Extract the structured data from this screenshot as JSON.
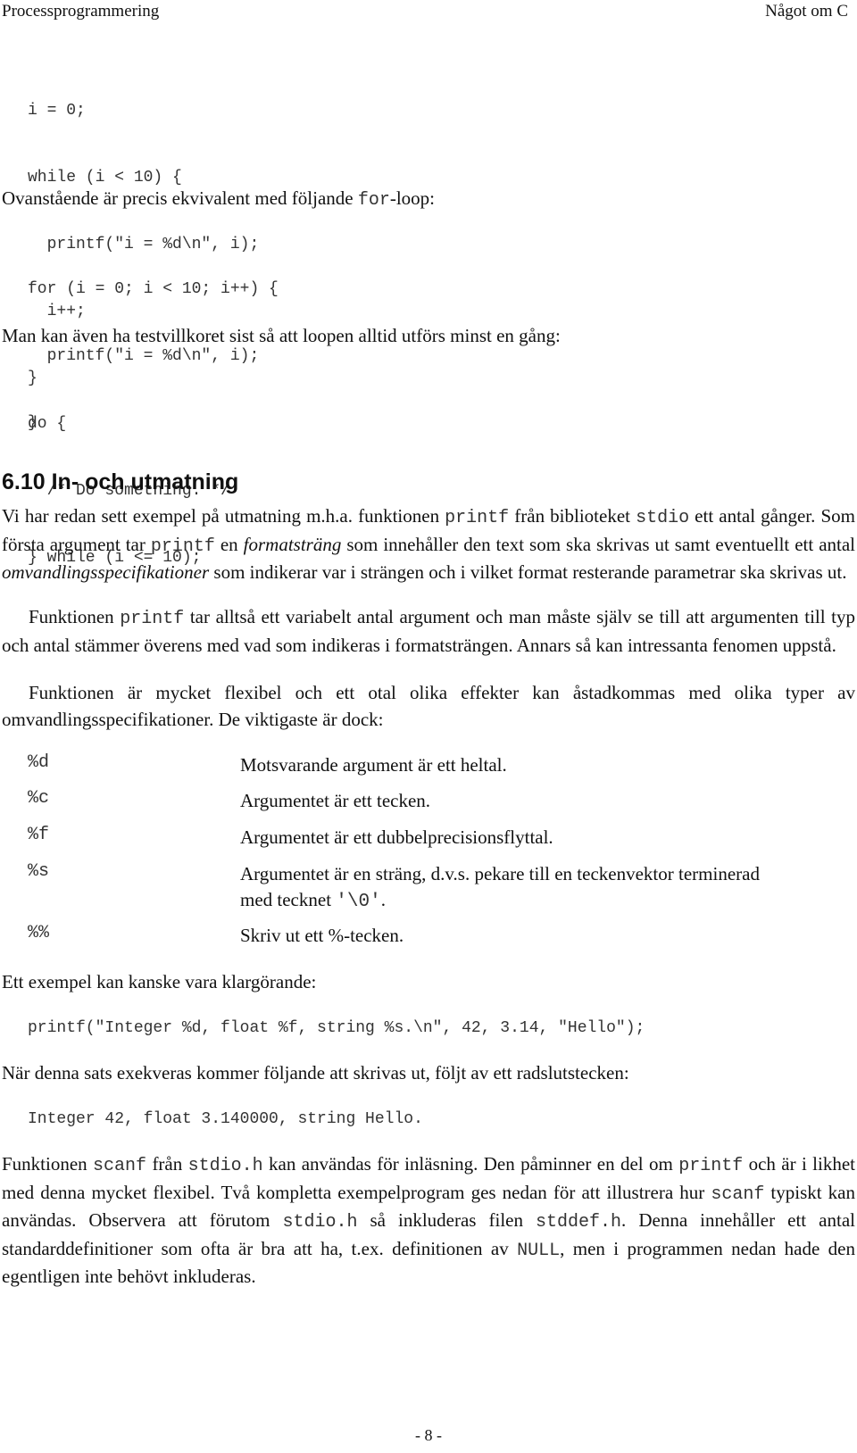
{
  "header": {
    "left": "Processprogrammering",
    "right": "Något om C"
  },
  "code_while": [
    "i = 0;",
    "while (i < 10) {",
    "  printf(\"i = %d\\n\", i);",
    "  i++;",
    "}"
  ],
  "p1": {
    "before": "Ovanstående är precis ekvivalent med följande ",
    "code": "for",
    "after": "-loop:"
  },
  "code_for": [
    "for (i = 0; i < 10; i++) {",
    "  printf(\"i = %d\\n\", i);",
    "}"
  ],
  "p2": "Man kan även ha testvillkoret sist så att loopen alltid utförs minst en gång:",
  "code_do": [
    "do {",
    "  /* Do something. */",
    "} while (i <= 10);"
  ],
  "section": {
    "title": "6.10  In- och utmatning"
  },
  "p3": {
    "t1": "Vi har redan sett exempel på utmatning m.h.a. funktionen ",
    "c1": "printf",
    "t2": " från biblioteket ",
    "c2": "stdio",
    "t3": " ett antal gånger. Som första argument tar ",
    "c3": "printf",
    "t4": " en ",
    "i1": "formatsträng",
    "t5": " som innehåller den text som ska skrivas ut samt eventuellt ett antal ",
    "i2": "omvandlingsspecifikationer",
    "t6": " som indikerar var i strängen och i vilket format resterande parametrar ska skrivas ut."
  },
  "p4": {
    "t1": "Funktionen ",
    "c1": "printf",
    "t2": " tar alltså ett variabelt antal argument och man måste själv se till att argumenten till typ och antal stämmer överens med vad som indikeras i formatsträngen. Annars så kan intressanta fenomen uppstå."
  },
  "p5": "Funktionen är mycket flexibel och ett otal olika effekter kan åstadkommas med olika typer av omvandlingsspecifikationer. De viktigaste är dock:",
  "specs": [
    {
      "code": "%d",
      "desc": "Motsvarande argument är ett heltal."
    },
    {
      "code": "%c",
      "desc": "Argumentet är ett tecken."
    },
    {
      "code": "%f",
      "desc": "Argumentet är ett dubbelprecisionsflyttal."
    },
    {
      "code": "%s",
      "desc": "Argumentet är en sträng, d.v.s. pekare till en teckenvektor terminerad med tecknet ",
      "desc_code": "'\\0'",
      "desc_end": "."
    },
    {
      "code": "%%",
      "desc": "Skriv ut ett %-tecken."
    }
  ],
  "p6": "Ett exempel kan kanske vara klargörande:",
  "code_example": "printf(\"Integer %d, float %f, string %s.\\n\", 42, 3.14, \"Hello\");",
  "p7": "När denna sats exekveras kommer följande att skrivas ut, följt av ett radslutstecken:",
  "code_output": "Integer 42, float 3.140000, string Hello.",
  "p8": {
    "t1": "Funktionen ",
    "c1": "scanf",
    "t2": " från ",
    "c2": "stdio.h",
    "t3": " kan användas för inläsning. Den påminner en del om ",
    "c3": "printf",
    "t4": " och är i likhet med denna mycket flexibel. Två kompletta exempelprogram ges nedan för att illustrera hur ",
    "c4": "scanf",
    "t5": " typiskt kan användas. Observera att förutom ",
    "c5": "stdio.h",
    "t6": " så inkluderas filen ",
    "c6": "stddef.h",
    "t7": ". Denna innehåller ett antal standarddefinitioner som ofta är bra att ha, t.ex. definitionen av ",
    "c7": "NULL",
    "t8": ", men i programmen nedan hade den egentligen inte behövt inkluderas."
  },
  "footer": {
    "page": "- 8 -"
  }
}
